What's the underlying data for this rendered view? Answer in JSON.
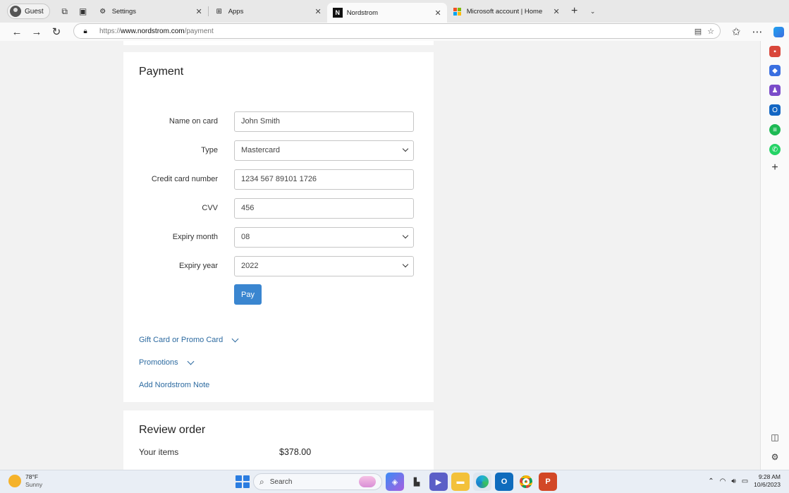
{
  "browser": {
    "profile_label": "Guest",
    "tabs": [
      {
        "title": "Settings",
        "icon": "gear-icon"
      },
      {
        "title": "Apps",
        "icon": "apps-grid-icon"
      },
      {
        "title": "Nordstrom",
        "icon": "nordstrom-n-icon"
      },
      {
        "title": "Microsoft account | Home",
        "icon": "microsoft-logo-icon"
      }
    ],
    "active_tab": "Nordstrom",
    "url_prefix": "https://",
    "url_domain": "www.nordstrom.com",
    "url_path": "/payment"
  },
  "payment": {
    "title": "Payment",
    "fields": [
      {
        "label": "Name on card",
        "value": "John Smith",
        "kind": "input"
      },
      {
        "label": "Type",
        "value": "Mastercard",
        "kind": "select"
      },
      {
        "label": "Credit card number",
        "value": "1234 567 89101 1726",
        "kind": "input"
      },
      {
        "label": "CVV",
        "value": "456",
        "kind": "input"
      },
      {
        "label": "Expiry month",
        "value": "08",
        "kind": "select"
      },
      {
        "label": "Expiry year",
        "value": "2022",
        "kind": "select"
      }
    ],
    "pay_label": "Pay",
    "links": {
      "gift_card": "Gift Card or Promo Card",
      "promotions": "Promotions",
      "note": "Add Nordstrom Note"
    }
  },
  "review": {
    "title": "Review order",
    "items_label": "Your items",
    "items_total": "$378.00"
  },
  "taskbar": {
    "weather_temp": "78°F",
    "weather_desc": "Sunny",
    "search_placeholder": "Search",
    "time": "9:28 AM",
    "date": "10/6/2023"
  },
  "colors": {
    "pay_button": "#3a86d0",
    "link": "#2c6aa0"
  }
}
